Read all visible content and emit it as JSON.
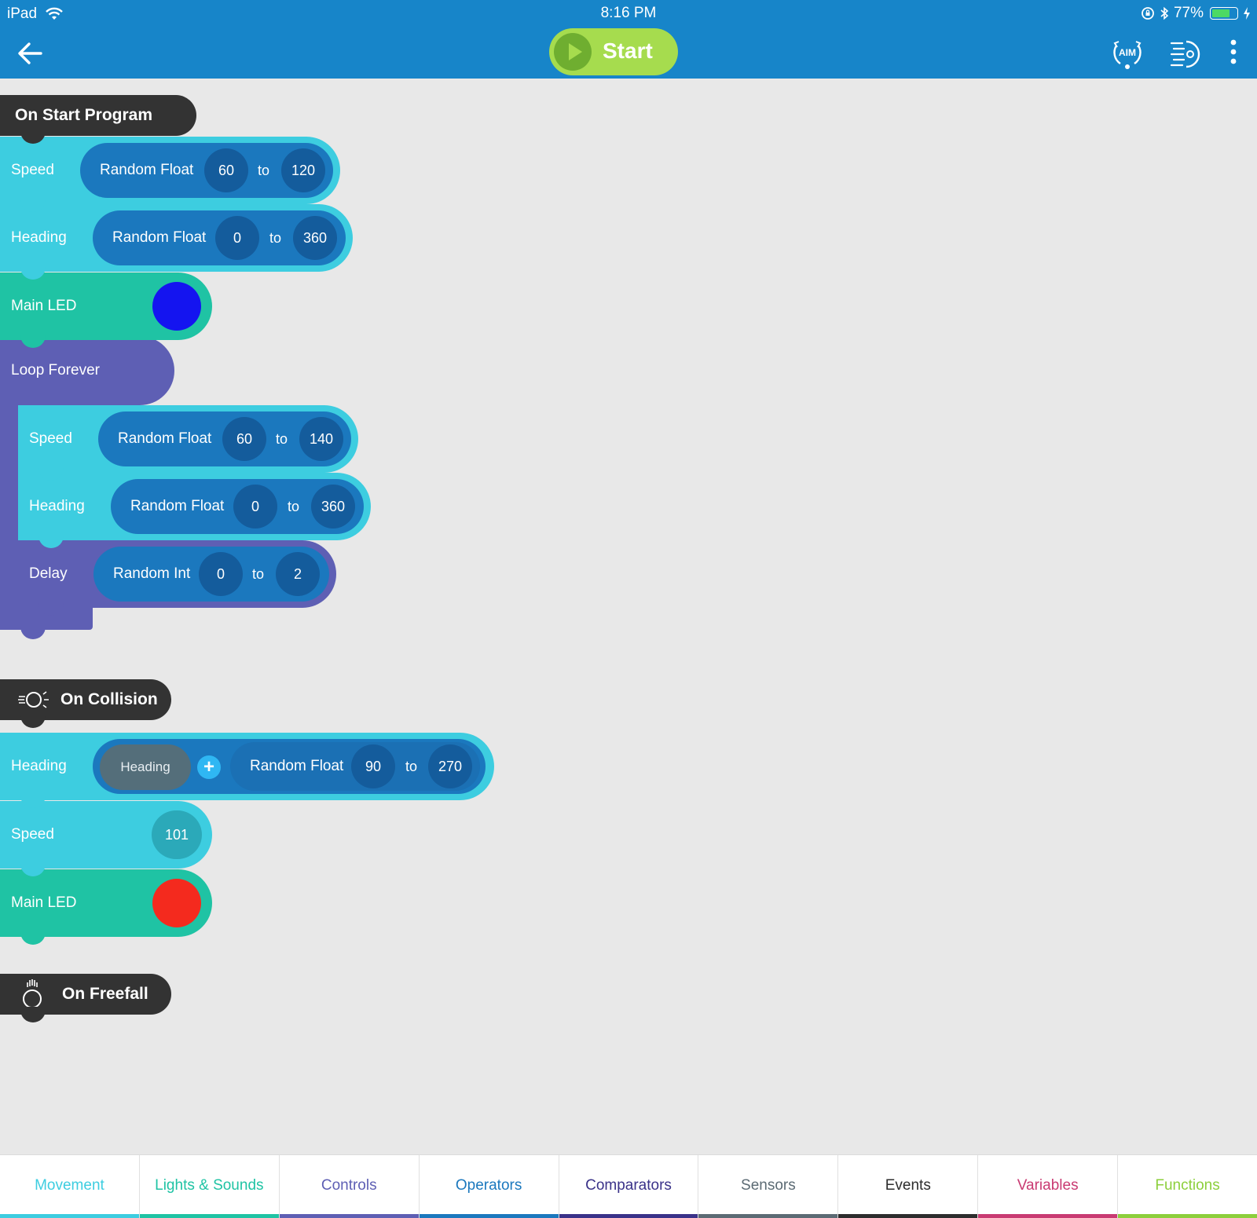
{
  "status_bar": {
    "device": "iPad",
    "time": "8:16 PM",
    "battery": "77%",
    "battery_level": 0.77
  },
  "toolbar": {
    "start_label": "Start",
    "aim_label": "AIM",
    "colors": {
      "bar": "#1785c9",
      "start": "#a6dc4e"
    }
  },
  "programs": {
    "on_start": {
      "title": "On Start Program",
      "speed": {
        "label": "Speed",
        "func": "Random Float",
        "min": "60",
        "to": "to",
        "max": "120"
      },
      "heading": {
        "label": "Heading",
        "func": "Random Float",
        "min": "0",
        "to": "to",
        "max": "360"
      },
      "main_led": {
        "label": "Main LED",
        "color": "#1414f0"
      },
      "loop": {
        "label": "Loop Forever",
        "speed": {
          "label": "Speed",
          "func": "Random Float",
          "min": "60",
          "to": "to",
          "max": "140"
        },
        "heading": {
          "label": "Heading",
          "func": "Random Float",
          "min": "0",
          "to": "to",
          "max": "360"
        },
        "delay": {
          "label": "Delay",
          "func": "Random Int",
          "min": "0",
          "to": "to",
          "max": "2"
        }
      }
    },
    "on_collision": {
      "title": "On Collision",
      "heading": {
        "label": "Heading",
        "operand": "Heading",
        "operator": "+",
        "func": "Random Float",
        "min": "90",
        "to": "to",
        "max": "270"
      },
      "speed": {
        "label": "Speed",
        "value": "101"
      },
      "main_led": {
        "label": "Main LED",
        "color": "#f42a1e"
      }
    },
    "on_freefall": {
      "title": "On Freefall"
    }
  },
  "tabs": [
    {
      "label": "Movement",
      "color": "#3dcde0"
    },
    {
      "label": "Lights & Sounds",
      "color": "#1fc3a4"
    },
    {
      "label": "Controls",
      "color": "#5e5fb4"
    },
    {
      "label": "Operators",
      "color": "#1b78be"
    },
    {
      "label": "Comparators",
      "color": "#3a3289"
    },
    {
      "label": "Sensors",
      "color": "#5c6b74"
    },
    {
      "label": "Events",
      "color": "#2d2d2d"
    },
    {
      "label": "Variables",
      "color": "#c93a72"
    },
    {
      "label": "Functions",
      "color": "#8ccf3c"
    }
  ]
}
